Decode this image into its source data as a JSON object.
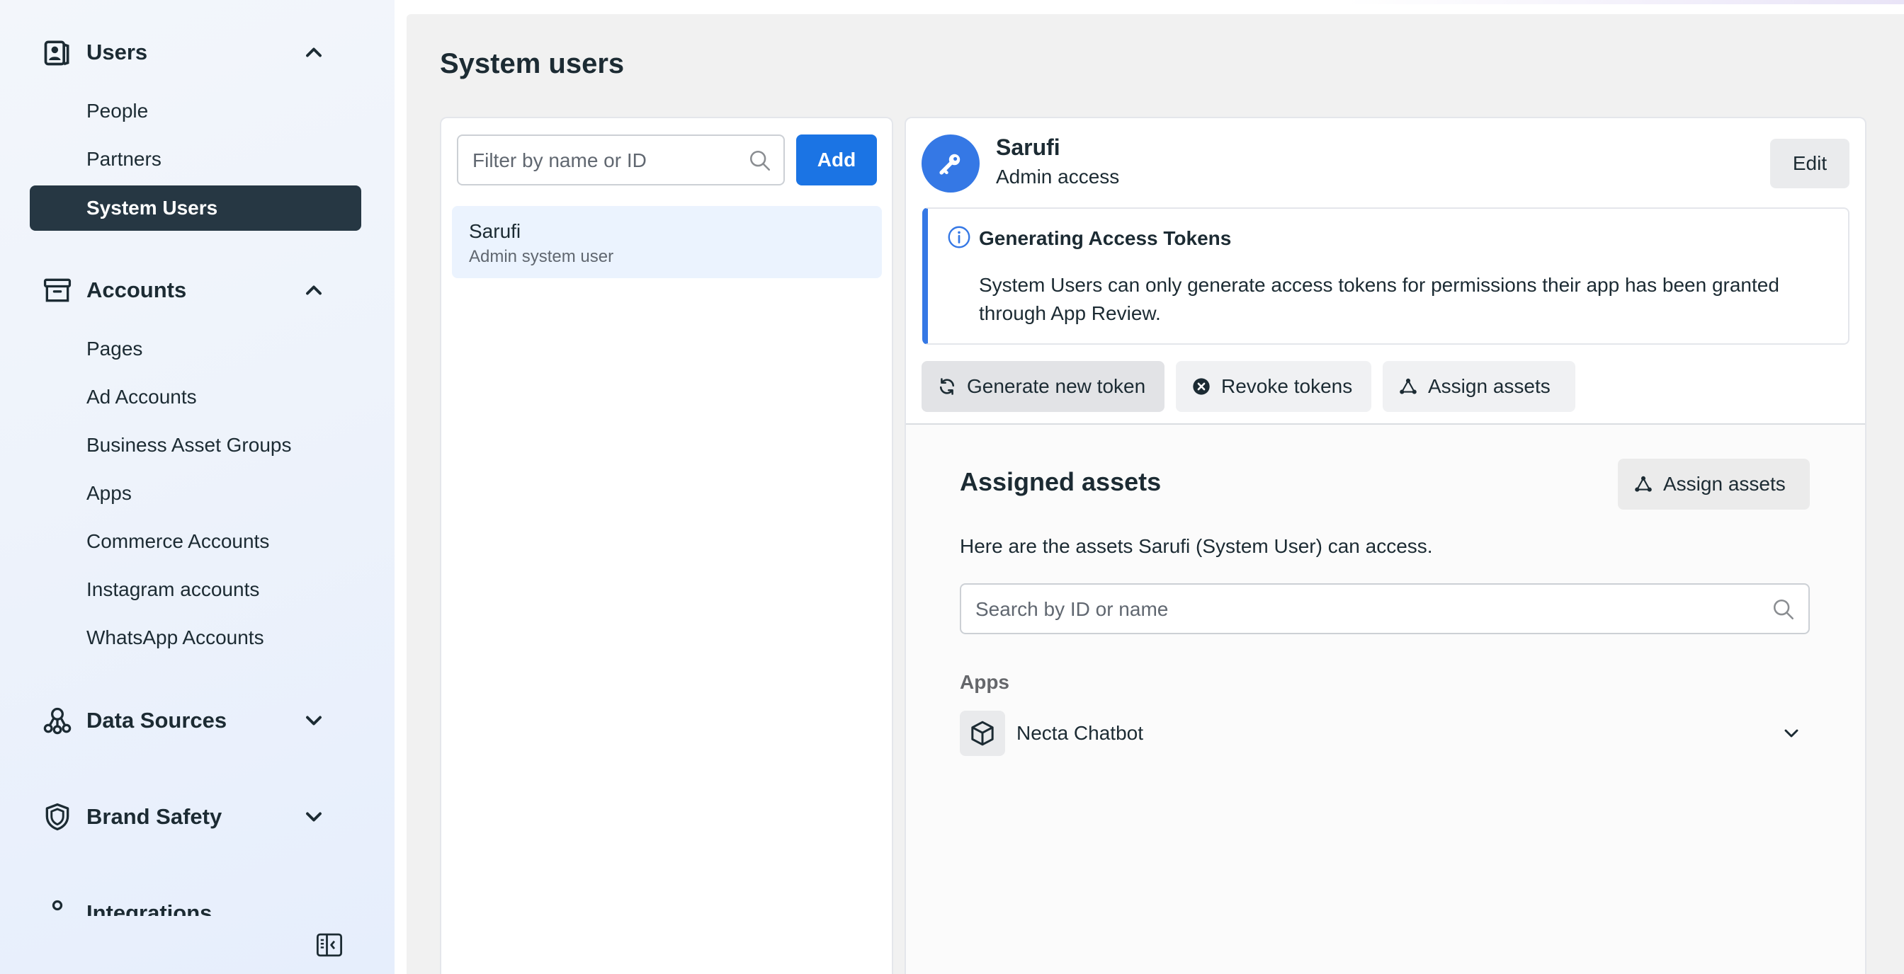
{
  "sidebar": {
    "sections": [
      {
        "title": "Users",
        "expanded": true,
        "icon": "users-icon"
      },
      {
        "title": "Accounts",
        "expanded": true,
        "icon": "archive-box-icon"
      },
      {
        "title": "Data Sources",
        "expanded": false,
        "icon": "data-sources-icon"
      },
      {
        "title": "Brand Safety",
        "expanded": false,
        "icon": "shield-icon"
      },
      {
        "title": "Integrations",
        "icon": "integrations-icon"
      }
    ],
    "users_items": [
      "People",
      "Partners",
      "System Users"
    ],
    "active_item": "System Users",
    "accounts_items": [
      "Pages",
      "Ad Accounts",
      "Business Asset Groups",
      "Apps",
      "Commerce Accounts",
      "Instagram accounts",
      "WhatsApp Accounts"
    ]
  },
  "page": {
    "title": "System users"
  },
  "list": {
    "filter_placeholder": "Filter by name or ID",
    "add_label": "Add",
    "users": [
      {
        "name": "Sarufi",
        "subtitle": "Admin system user"
      }
    ]
  },
  "detail": {
    "name": "Sarufi",
    "role": "Admin access",
    "edit_label": "Edit",
    "notice": {
      "title": "Generating Access Tokens",
      "body": "System Users can only generate access tokens for permissions their app has been granted through App Review."
    },
    "actions": {
      "generate": "Generate new token",
      "revoke": "Revoke tokens",
      "assign": "Assign assets"
    },
    "assigned": {
      "title": "Assigned assets",
      "assign_label": "Assign assets",
      "description": "Here are the assets Sarufi (System User) can access.",
      "search_placeholder": "Search by ID or name",
      "group_label": "Apps",
      "apps": [
        {
          "name": "Necta Chatbot"
        }
      ]
    }
  },
  "colors": {
    "accent": "#1b74e4",
    "active_nav": "#263743",
    "selected_row": "#ebf3fe"
  }
}
